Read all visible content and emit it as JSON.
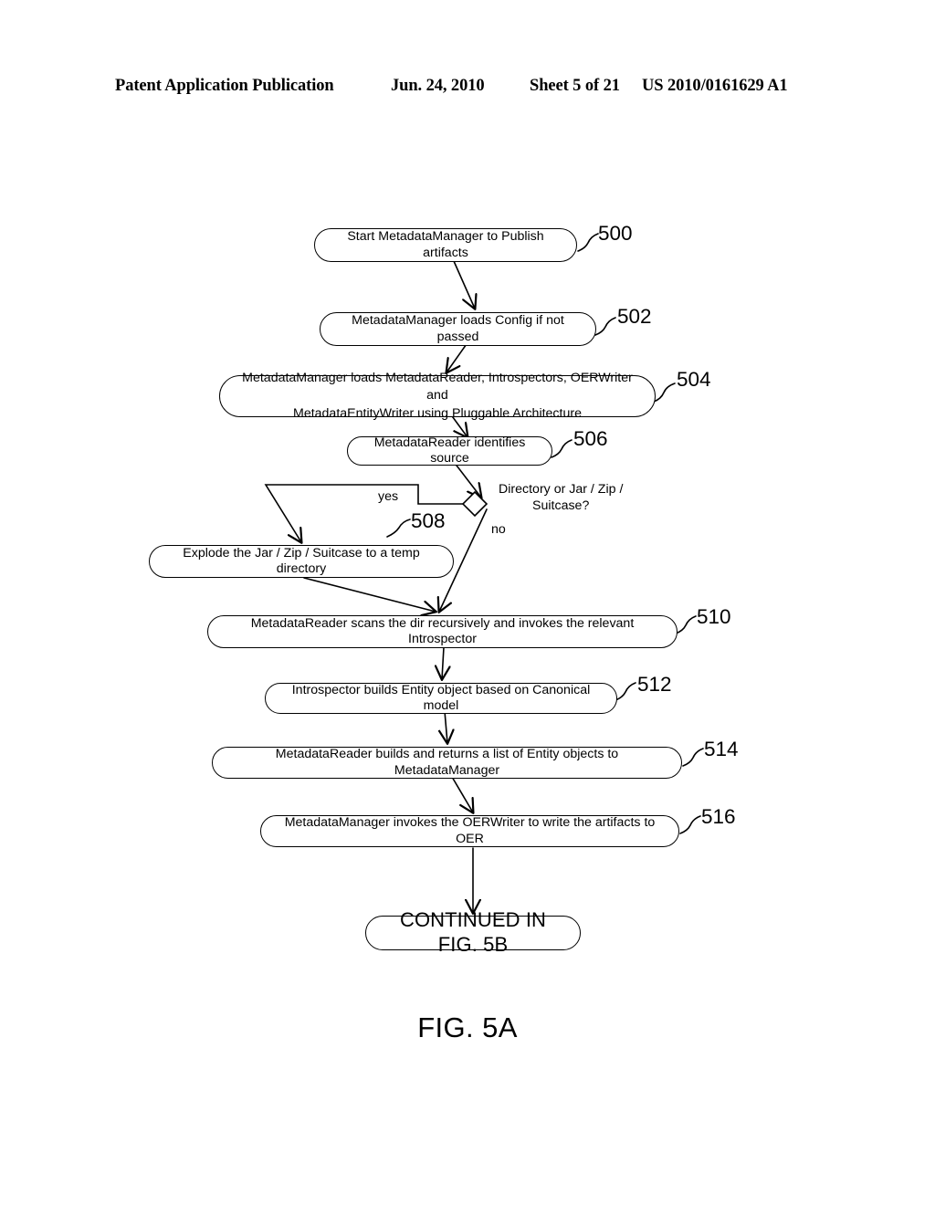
{
  "header": {
    "publication": "Patent Application Publication",
    "date": "Jun. 24, 2010",
    "sheet": "Sheet 5 of 21",
    "patent_number": "US 2010/0161629 A1"
  },
  "figure": {
    "caption": "FIG. 5A"
  },
  "diagram": {
    "type": "flowchart",
    "nodes": [
      {
        "ref": "500",
        "shape": "stadium",
        "label": "Start MetadataManager to Publish artifacts"
      },
      {
        "ref": "502",
        "shape": "stadium",
        "label": "MetadataManager loads Config if not passed"
      },
      {
        "ref": "504",
        "shape": "stadium",
        "label_line1": "MetadataManager loads MetadataReader, Introspectors, OERWriter and",
        "label_line2": "MetadataEntityWriter using Pluggable Architecture"
      },
      {
        "ref": "506",
        "shape": "stadium",
        "label": "MetadataReader identifies source"
      },
      {
        "ref": "508",
        "shape": "stadium",
        "label": "Explode the Jar / Zip / Suitcase to a temp directory"
      },
      {
        "ref": "510",
        "shape": "stadium",
        "label": "MetadataReader scans the dir recursively and invokes the relevant Introspector"
      },
      {
        "ref": "512",
        "shape": "stadium",
        "label": "Introspector builds Entity object based on Canonical model"
      },
      {
        "ref": "514",
        "shape": "stadium",
        "label": "MetadataReader builds and  returns a list of Entity objects to MetadataManager"
      },
      {
        "ref": "516",
        "shape": "stadium",
        "label": "MetadataManager invokes the OERWriter to write the artifacts to OER"
      },
      {
        "ref": "",
        "shape": "stadium-terminal",
        "label": "CONTINUED IN FIG. 5B"
      }
    ],
    "decision": {
      "question_line1": "Directory or Jar / Zip /",
      "question_line2": "Suitcase?",
      "branch_yes": "yes",
      "branch_no": "no"
    }
  }
}
